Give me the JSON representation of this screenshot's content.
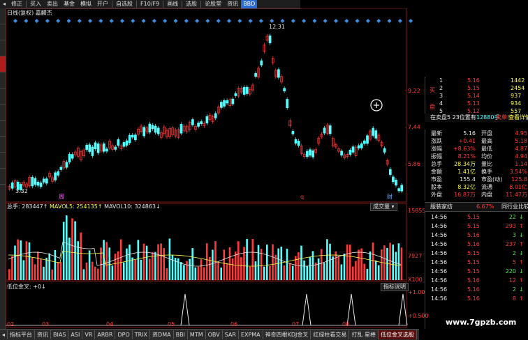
{
  "toolbar": {
    "items": [
      "修正",
      "买入",
      "卖出",
      "基金",
      "模拟",
      "开户",
      "自选股",
      "F10/F9",
      "画线",
      "选股",
      "论股堂",
      "资讯"
    ],
    "badge": "BBD"
  },
  "chart": {
    "title": "日线(复权) 嘉麟杰",
    "high_label": "12.31",
    "low_label": "3.32",
    "marker_weekly": "周",
    "marker_q": "q",
    "marker_cai": "财",
    "price_axis": [
      "9.22",
      "7.44",
      "5.86"
    ],
    "cursor_icon": "crosshair-icon"
  },
  "volume": {
    "label_main": "总手: 283447↑",
    "label_ma5": "MAVOL5: 254135↑",
    "label_ma10": "MAVOL10: 324863↓",
    "axis": [
      "15855",
      "7927",
      "X100"
    ],
    "button": "成交量"
  },
  "indicator": {
    "label": "低位金叉: +0↓",
    "axis": [
      "+1.00",
      "+0.500"
    ],
    "button": "指标说明"
  },
  "dates": [
    "02",
    "03",
    "04",
    "05",
    "06",
    "07",
    "08"
  ],
  "orderbook": {
    "side_label_top": "买",
    "side_label_bottom": "盘",
    "rows": [
      {
        "n": "1",
        "price": "5.16",
        "vol": "1442"
      },
      {
        "n": "2",
        "price": "5.15",
        "vol": "2454"
      },
      {
        "n": "3",
        "price": "5.14",
        "vol": "937"
      },
      {
        "n": "4",
        "price": "5.13",
        "vol": "934"
      },
      {
        "n": "5",
        "price": "5.12",
        "vol": "557"
      }
    ]
  },
  "status_line": {
    "a": "在卖盘5 23位置有",
    "b": "12880手",
    "c": "卖单!",
    "d": "查看详情"
  },
  "quote": [
    {
      "k1": "最新",
      "v1": "5.16",
      "k2": "开盘",
      "v2": "4.95"
    },
    {
      "k1": "涨跌",
      "v1": "+0.41",
      "k2": "最高",
      "v2": "5.18"
    },
    {
      "k1": "涨幅",
      "v1": "+8.63%",
      "k2": "最低",
      "v2": "4.87"
    },
    {
      "k1": "振幅",
      "v1": "8.21%",
      "k2": "均价",
      "v2": "4.94"
    },
    {
      "k1": "总手",
      "v1": "28.34万",
      "k2": "量比",
      "v2": "1.14"
    },
    {
      "k1": "金额",
      "v1": "1.41亿",
      "k2": "换手",
      "v2": "3.54%"
    },
    {
      "k1": "市盈",
      "v1": "155.4",
      "k2": "市盈(动)",
      "v2": "125.8"
    },
    {
      "k1": "股本",
      "v1": "8.32亿",
      "k2": "流通",
      "v2": "8.01亿"
    },
    {
      "k1": "外盘",
      "v1": "16.87万",
      "k2": "内盘",
      "v2": "11.47万"
    }
  ],
  "panel_tabs": {
    "left": "服装家纺",
    "mid": "6.67%",
    "right": "同行业比较"
  },
  "ticks": [
    {
      "t": "14:56",
      "p": "5.15",
      "v": "22"
    },
    {
      "t": "14:56",
      "p": "5.15",
      "v": "293"
    },
    {
      "t": "14:56",
      "p": "5.16",
      "v": "3"
    },
    {
      "t": "14:56",
      "p": "5.16",
      "v": "237"
    },
    {
      "t": "14:56",
      "p": "5.15",
      "v": "2"
    },
    {
      "t": "14:56",
      "p": "5.15",
      "v": "5"
    },
    {
      "t": "14:56",
      "p": "5.15",
      "v": "220"
    },
    {
      "t": "14:56",
      "p": "5.16",
      "v": "12"
    },
    {
      "t": "14:56",
      "p": "5.16",
      "v": "2"
    },
    {
      "t": "14:56",
      "p": "5.16",
      "v": "8"
    }
  ],
  "watermark": "www.7gpzb.com",
  "tabs": [
    "指标平台",
    "资讯",
    "BIAS",
    "ASI",
    "VR",
    "ARBR",
    "DPO",
    "TRIX",
    "资DMA",
    "BBI",
    "MTM",
    "OBV",
    "SAR",
    "EXPMA",
    "神奇四根KDJ金叉",
    "红绿柱看交易",
    "打乱 星棒",
    "低位金叉选股"
  ],
  "colors": {
    "up": "#ff3a3a",
    "down": "#54ffff",
    "ma_white": "#e8e8e8",
    "ma_yellow": "#ffff4d",
    "accent_blue": "#2a6bd1"
  }
}
